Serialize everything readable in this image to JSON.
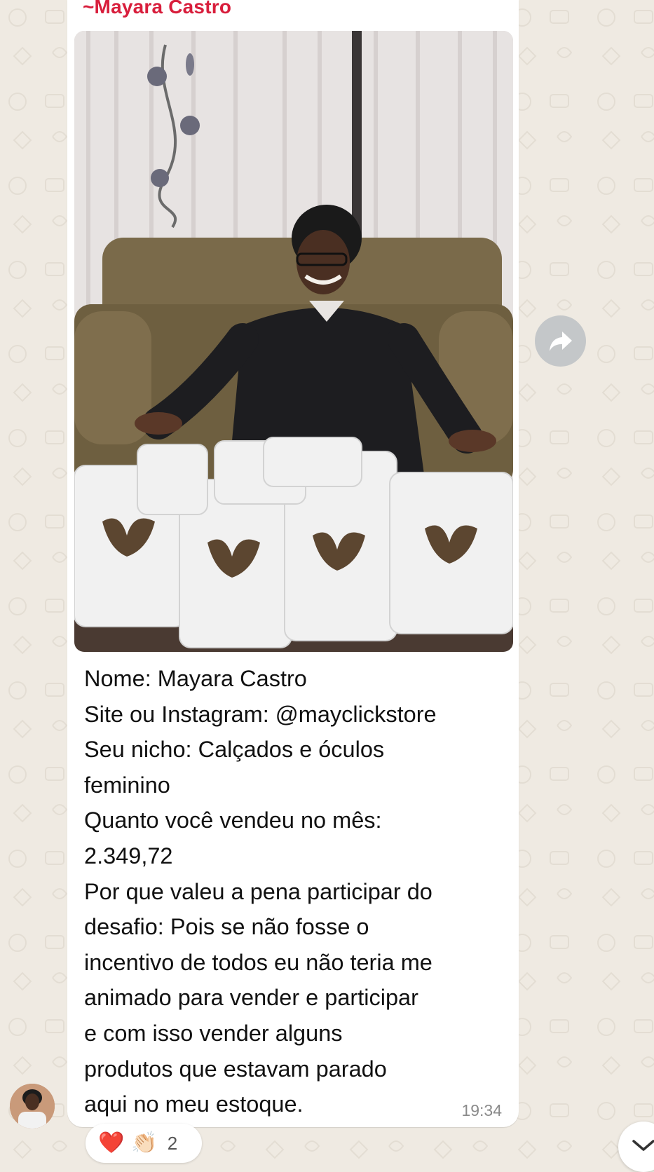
{
  "message": {
    "sender": "~Mayara Castro",
    "text_lines": [
      "Nome: Mayara Castro",
      "Site ou Instagram: @mayclickstore",
      "Seu nicho: Calçados e óculos",
      "feminino",
      "Quanto você vendeu no mês:",
      "2.349,72",
      "Por que valeu a pena participar do",
      "desafio: Pois se não fosse o",
      "incentivo de todos eu não teria me",
      "animado para vender e participar",
      "e com isso vender alguns",
      "produtos que estavam parado",
      "aqui no meu estoque."
    ],
    "time": "19:34"
  },
  "reactions": {
    "emoji_1": "❤️",
    "emoji_2": "👏🏻",
    "count": "2"
  },
  "icons": {
    "forward": "forward-arrow-icon",
    "scroll": "chevron-down-icon"
  },
  "colors": {
    "sender_name": "#d81e3c",
    "wallpaper": "#efeae2",
    "bubble": "#ffffff"
  }
}
